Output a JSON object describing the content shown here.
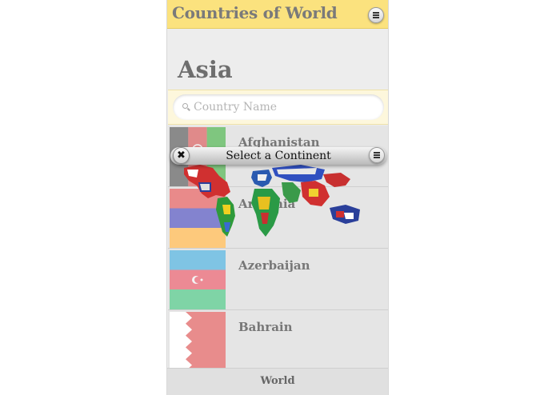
{
  "header": {
    "title": "Countries of World",
    "menu_icon": "menu-icon"
  },
  "continent": {
    "title": "Asia"
  },
  "search": {
    "placeholder": "Country Name",
    "value": ""
  },
  "countries": [
    {
      "name": "Afghanistan"
    },
    {
      "name": "Armenia"
    },
    {
      "name": "Azerbaijan"
    },
    {
      "name": "Bahrain"
    }
  ],
  "footer": {
    "tab": "World"
  },
  "popup": {
    "title": "Select a Continent",
    "close_icon": "close-icon",
    "menu_icon": "menu-icon"
  },
  "colors": {
    "header_bg": "#fbe27e",
    "page_bg": "#ededed",
    "text_gray": "#777777"
  }
}
